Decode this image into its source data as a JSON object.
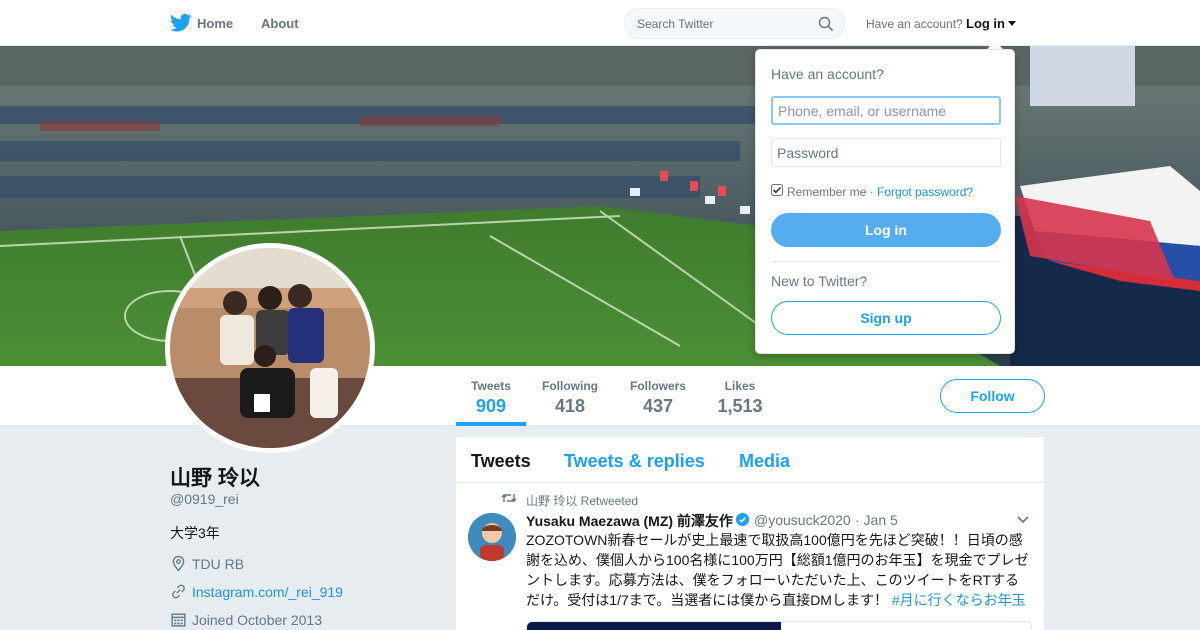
{
  "topbar": {
    "home_label": "Home",
    "about_label": "About",
    "search_placeholder": "Search Twitter",
    "have_account": "Have an account?",
    "login_label": "Log in"
  },
  "profile": {
    "name": "山野 玲以",
    "handle": "@0919_rei",
    "bio": "大学3年",
    "location": "TDU RB",
    "link": "Instagram.com/_rei_919",
    "joined": "Joined October 2013",
    "follow_label": "Follow",
    "stats": [
      {
        "label": "Tweets",
        "value": "909"
      },
      {
        "label": "Following",
        "value": "418"
      },
      {
        "label": "Followers",
        "value": "437"
      },
      {
        "label": "Likes",
        "value": "1,513"
      }
    ]
  },
  "timeline": {
    "tabs": [
      "Tweets",
      "Tweets & replies",
      "Media"
    ],
    "tweet": {
      "retweet_context": "山野 玲以 Retweeted",
      "author_name": "Yusaku Maezawa (MZ) 前澤友作",
      "author_handle": "@yousuck2020",
      "date": "· Jan 5",
      "text": "ZOZOTOWN新春セールが史上最速で取扱高100億円を先ほど突破！！日頃の感謝を込め、僕個人から100名様に100万円【総額1億円のお年玉】を現金でプレゼントします。応募方法は、僕をフォローいただいた上、このツイートをRTするだけ。受付は1/7まで。当選者には僕から直接DMします！",
      "hashtag": "#月に行くならお年玉"
    }
  },
  "login_dropdown": {
    "title": "Have an account?",
    "username_placeholder": "Phone, email, or username",
    "password_placeholder": "Password",
    "remember_label": "Remember me",
    "separator": " · ",
    "forgot_label": "Forgot password?",
    "login_button": "Log in",
    "new_label": "New to Twitter?",
    "signup_button": "Sign up"
  },
  "colors": {
    "accent": "#1da1f2",
    "login_button": "#55acee",
    "text_secondary": "#657786",
    "background": "#e6ecf0"
  },
  "icons": [
    "twitter-bird-icon",
    "search-icon",
    "caret-down-icon",
    "location-icon",
    "link-icon",
    "calendar-icon",
    "retweet-icon",
    "verified-badge-icon",
    "chevron-down-icon"
  ]
}
